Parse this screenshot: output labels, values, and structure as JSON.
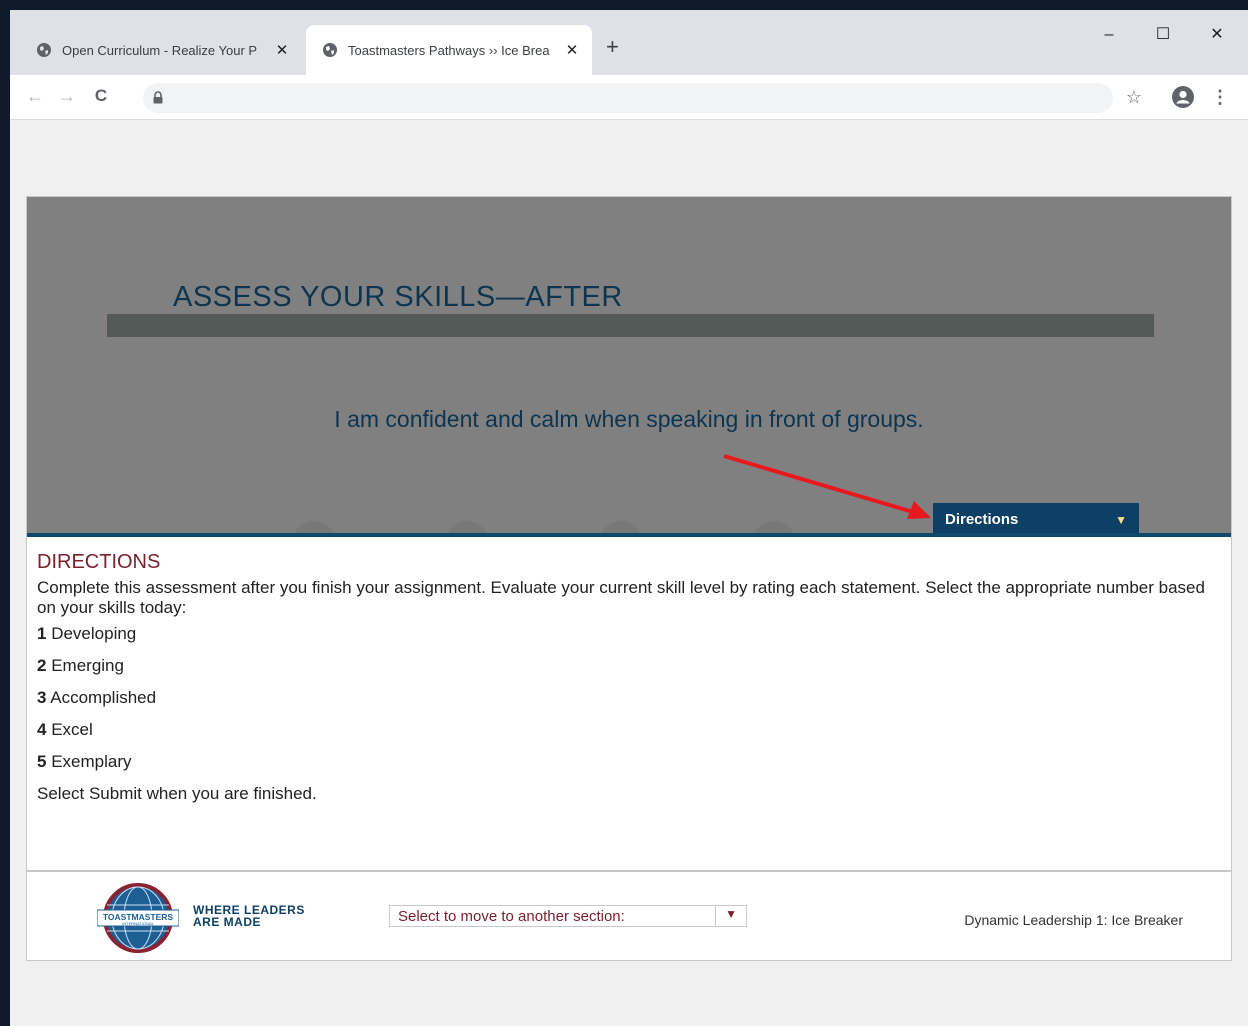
{
  "browser": {
    "tabs": [
      {
        "title": "Open Curriculum - Realize Your P",
        "active": false
      },
      {
        "title": "Toastmasters Pathways ›› Ice Brea",
        "active": true
      }
    ],
    "new_tab_symbol": "+",
    "window_controls": {
      "minimize": "–",
      "maximize": "☐",
      "close": "✕"
    },
    "nav": {
      "back": "←",
      "forward": "→",
      "reload": "C"
    },
    "toolbar_icons": [
      "star-icon",
      "profile-icon",
      "kebab-menu-icon"
    ]
  },
  "content": {
    "banner_title": "ASSESS YOUR SKILLS—AFTER",
    "statement": "I am confident and calm when speaking in front of groups.",
    "directions_button": "Directions",
    "directions": {
      "heading": "DIRECTIONS",
      "intro": "Complete this assessment after you finish your assignment. Evaluate your current skill level by rating each statement. Select the appropriate number based on your skills today:",
      "levels": [
        {
          "num": "1",
          "label": "Developing"
        },
        {
          "num": "2",
          "label": "Emerging"
        },
        {
          "num": "3",
          "label": "Accomplished"
        },
        {
          "num": "4",
          "label": "Excel"
        },
        {
          "num": "5",
          "label": "Exemplary"
        }
      ],
      "outro": "Select Submit when you are finished."
    },
    "footer": {
      "tagline_line1": "WHERE LEADERS",
      "tagline_line2": "ARE MADE",
      "logo_text": "TOASTMASTERS",
      "logo_subtext": "INTERNATIONAL",
      "section_select": "Select to move to another section:",
      "module_name": "Dynamic Leadership 1: Ice Breaker"
    }
  },
  "colors": {
    "banner_gray": "#808080",
    "navy": "#0e3f64",
    "maroon": "#7a1f2b",
    "annotation_arrow": "#e8191e"
  }
}
